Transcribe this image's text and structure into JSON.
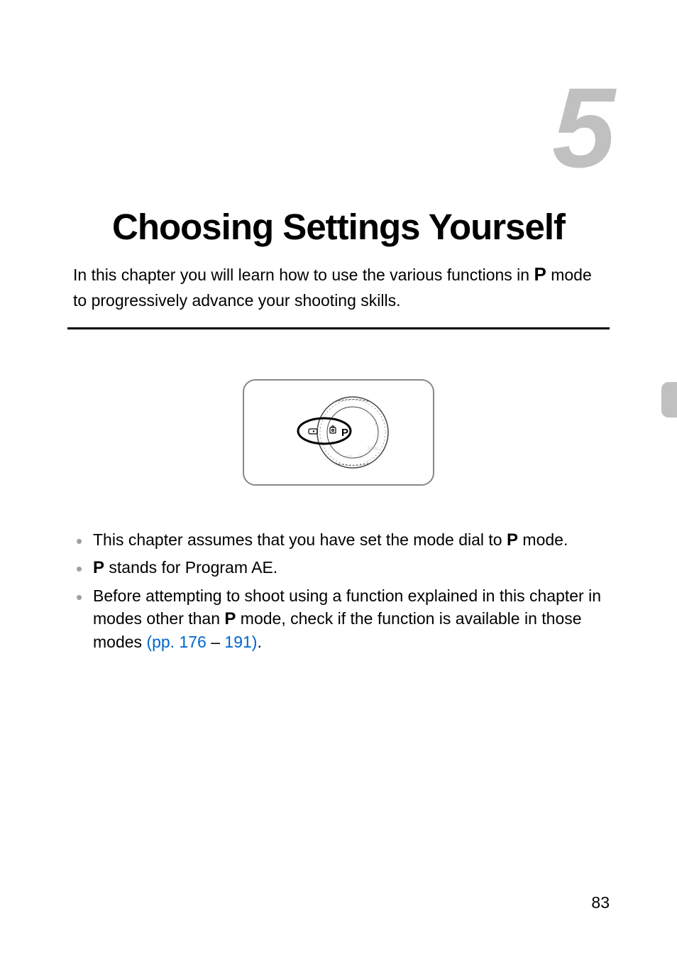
{
  "chapter": {
    "number": "5",
    "title": "Choosing Settings Yourself"
  },
  "intro": {
    "part1": "In this chapter you will learn how to use the various functions in ",
    "p_glyph": "P",
    "part2": " mode to progressively advance your shooting skills."
  },
  "bullets": {
    "item1": {
      "part1": "This chapter assumes that you have set the mode dial to ",
      "p_glyph": "P",
      "part2": " mode."
    },
    "item2": {
      "p_glyph": "P",
      "part1": " stands for Program AE."
    },
    "item3": {
      "part1": "Before attempting to shoot using a function explained in this chapter in modes other than ",
      "p_glyph": "P",
      "part2": " mode, check if the function is available in those modes ",
      "link1": "(pp. 176",
      "dash": " – ",
      "link2": "191)",
      "period": "."
    }
  },
  "pageNumber": "83"
}
